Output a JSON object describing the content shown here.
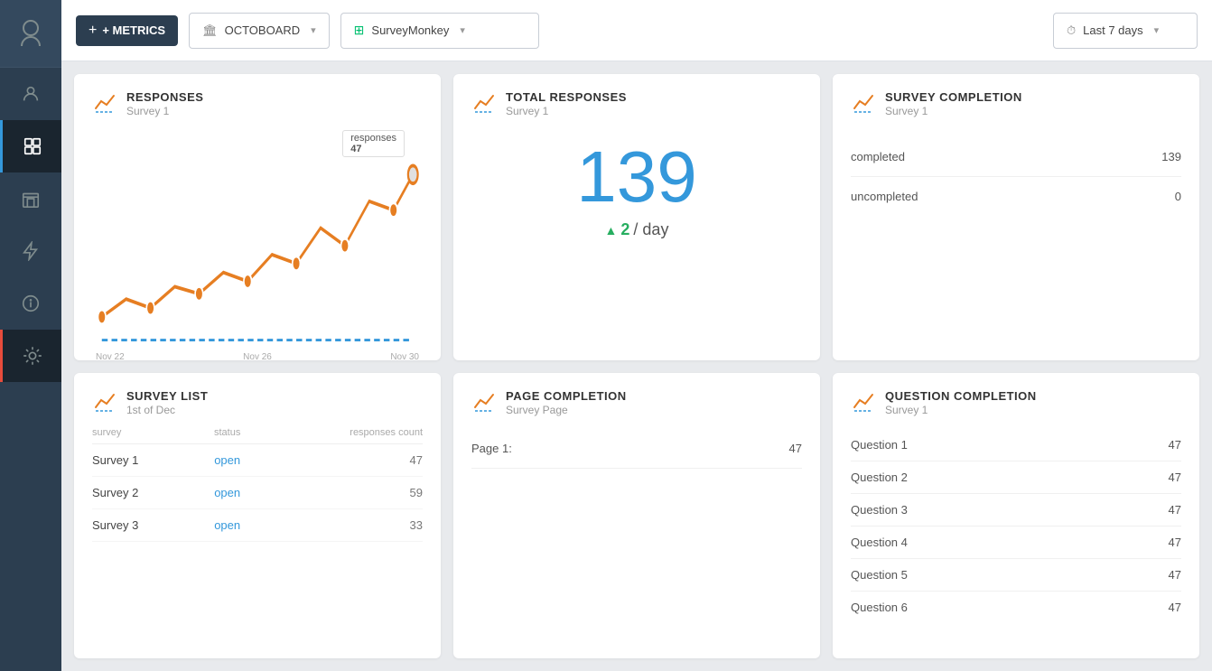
{
  "topbar": {
    "add_label": "+ METRICS",
    "board_label": "OCTOBOARD",
    "integration_label": "SurveyMonkey",
    "time_label": "Last 7 days"
  },
  "sidebar": {
    "items": [
      {
        "name": "user-icon",
        "label": "User",
        "active": false
      },
      {
        "name": "dashboard-icon",
        "label": "Dashboard",
        "active": true
      },
      {
        "name": "building-icon",
        "label": "Building",
        "active": false
      },
      {
        "name": "lightning-icon",
        "label": "Integrations",
        "active": false
      },
      {
        "name": "info-icon",
        "label": "Info",
        "active": false
      },
      {
        "name": "bug-icon",
        "label": "Settings",
        "active": false
      }
    ]
  },
  "responses_card": {
    "title": "RESPONSES",
    "subtitle": "Survey 1",
    "tooltip_label": "responses",
    "tooltip_value": "47",
    "x_axis": [
      "Nov 22",
      "Nov 26",
      "Nov 30"
    ],
    "chart_data": [
      10,
      15,
      12,
      18,
      14,
      20,
      25,
      30,
      22,
      35,
      28,
      40,
      38,
      47
    ]
  },
  "total_card": {
    "title": "TOTAL RESPONSES",
    "subtitle": "Survey 1",
    "number": "139",
    "rate": "2",
    "rate_label": "/ day"
  },
  "survey_completion_card": {
    "title": "SURVEY COMPLETION",
    "subtitle": "Survey 1",
    "rows": [
      {
        "label": "completed",
        "value": "139"
      },
      {
        "label": "uncompleted",
        "value": "0"
      }
    ]
  },
  "survey_list_card": {
    "title": "SURVEY LIST",
    "subtitle": "1st of Dec",
    "columns": [
      "survey",
      "status",
      "responses count"
    ],
    "rows": [
      {
        "survey": "Survey 1",
        "status": "open",
        "count": "47"
      },
      {
        "survey": "Survey 2",
        "status": "open",
        "count": "59"
      },
      {
        "survey": "Survey 3",
        "status": "open",
        "count": "33"
      }
    ]
  },
  "page_completion_card": {
    "title": "PAGE COMPLETION",
    "subtitle": "Survey Page",
    "rows": [
      {
        "label": "Page 1:",
        "value": "47"
      }
    ]
  },
  "question_completion_card": {
    "title": "QUESTION COMPLETION",
    "subtitle": "Survey 1",
    "rows": [
      {
        "label": "Question 1",
        "value": "47"
      },
      {
        "label": "Question 2",
        "value": "47"
      },
      {
        "label": "Question 3",
        "value": "47"
      },
      {
        "label": "Question 4",
        "value": "47"
      },
      {
        "label": "Question 5",
        "value": "47"
      },
      {
        "label": "Question 6",
        "value": "47"
      }
    ]
  }
}
